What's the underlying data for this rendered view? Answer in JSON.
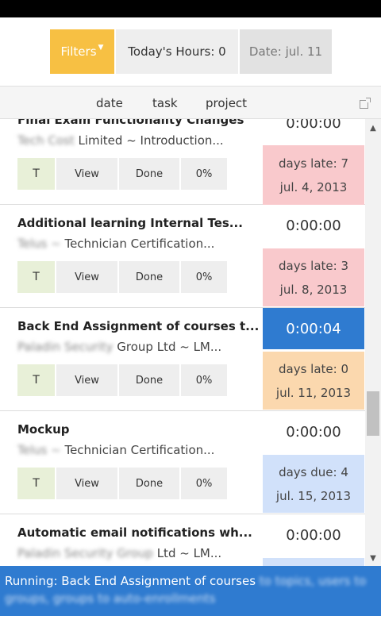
{
  "header": {
    "filters_label": "Filters",
    "hours_label": "Today's Hours: 0",
    "date_label": "Date: jul. 11"
  },
  "sort": {
    "date": "date",
    "task": "task",
    "project": "project"
  },
  "tasks": [
    {
      "title": "Final Exam Functionality Changes",
      "client": "Tech Cost",
      "project": "Limited ~ Introduction...",
      "timer": "0:00:00",
      "due_label": "days late: 7",
      "due_date": "jul. 4, 2013",
      "status": "late"
    },
    {
      "title": "Additional learning Internal Tes...",
      "client": "Telus ~",
      "project": "Technician Certification...",
      "timer": "0:00:00",
      "due_label": "days late: 3",
      "due_date": "jul. 8, 2013",
      "status": "late"
    },
    {
      "title": "Back End Assignment of courses t...",
      "client": "Paladin Security",
      "project": "Group Ltd ~ LM...",
      "timer": "0:00:04",
      "due_label": "days late: 0",
      "due_date": "jul. 11, 2013",
      "status": "today"
    },
    {
      "title": "Mockup",
      "client": "Telus ~",
      "project": "Technician Certification...",
      "timer": "0:00:00",
      "due_label": "days due: 4",
      "due_date": "jul. 15, 2013",
      "status": "ahead"
    },
    {
      "title": "Automatic email notifications wh...",
      "client": "Paladin Security Group",
      "project": "Ltd ~ LM...",
      "timer": "0:00:00",
      "due_label": "",
      "due_date": "",
      "status": "ahead"
    }
  ],
  "task_buttons": {
    "t": "T",
    "view": "View",
    "done": "Done",
    "percent": "0%"
  },
  "running": {
    "prefix": "Running: Back End Assignment of courses",
    "rest": "to topics, users to groups, groups to auto-enrollments"
  },
  "colors": {
    "accent": "#f7c043",
    "running_blue": "#2f7bd0",
    "late_bg": "#f9c9cc",
    "today_bg": "#fbd8ae",
    "ahead_bg": "#d1e1fa",
    "t_button_bg": "#e8f0d8"
  },
  "icons": {
    "filters_caret": "caret-down-icon",
    "popout": "external-link-icon",
    "scroll_up": "chevron-up-icon",
    "scroll_down": "chevron-down-icon"
  }
}
